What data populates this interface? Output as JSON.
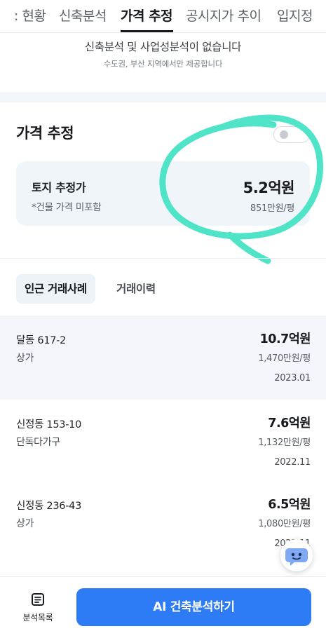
{
  "tabs": [
    {
      "label": ": 현황"
    },
    {
      "label": "신축분석"
    },
    {
      "label": "가격 추정"
    },
    {
      "label": "공시지가 추이"
    },
    {
      "label": "입지정"
    }
  ],
  "notice": {
    "title": "신축분석 및 사업성분석이 없습니다",
    "subtitle": "수도권, 부산 지역에서만 제공합니다"
  },
  "price": {
    "section_title": "가격 추정",
    "card_label": "토지 추정가",
    "card_sub": "*건물 가격 미포함",
    "card_value": "5.2억원",
    "card_unit": "851만원/평"
  },
  "subtabs": [
    {
      "label": "인근 거래사례"
    },
    {
      "label": "거래이력"
    }
  ],
  "transactions": [
    {
      "address": "달동 617-2",
      "type": "상가",
      "price": "10.7억원",
      "unit_price": "1,470만원/평",
      "date": "2023.01"
    },
    {
      "address": "신정동 153-10",
      "type": "단독다가구",
      "price": "7.6억원",
      "unit_price": "1,132만원/평",
      "date": "2022.11"
    },
    {
      "address": "신정동 236-43",
      "type": "상가",
      "price": "6.5억원",
      "unit_price": "1,080만원/평",
      "date": "2022.11"
    }
  ],
  "bottom": {
    "list_label": "분석목록",
    "cta_label": "AI 건축분석하기"
  },
  "colors": {
    "accent": "#2d7cf6",
    "highlight_marker": "#4fe3c8",
    "card_bg": "#f0f5fa"
  },
  "icons": {
    "list": "list-document-icon",
    "chatbot": "chatbot-face-icon",
    "toggle": "toggle-switch"
  }
}
